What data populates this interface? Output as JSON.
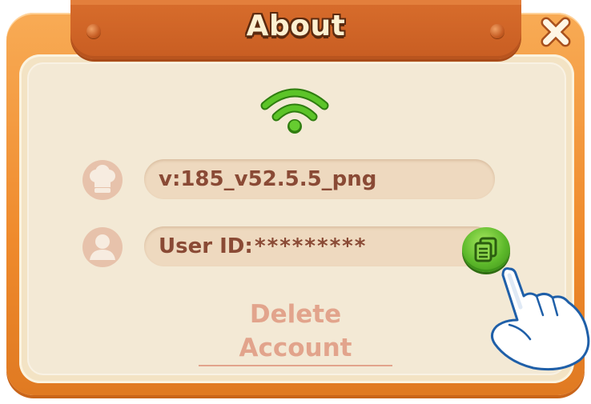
{
  "dialog": {
    "title": "About",
    "close_icon": "close-x-icon",
    "status_icon": "wifi-signal-icon",
    "version_icon": "chef-hat-icon",
    "version_text": "v:185_v52.5.5_png",
    "user_icon": "user-profile-icon",
    "user_id_label": "User ID:",
    "user_id_value": "*********",
    "copy_icon": "copy-icon",
    "delete_account_label": "Delete Account",
    "pointer_icon": "tutorial-pointing-hand-icon"
  },
  "colors": {
    "frame_orange": "#ef8a2c",
    "title_tab": "#c85d22",
    "panel_cream": "#f3e9d5",
    "field_bg": "#eed9bf",
    "text_brown": "#8a4a35",
    "wifi_green": "#4fbf1e",
    "copy_green": "#5cb82a",
    "delete_link": "#e2a48c"
  }
}
